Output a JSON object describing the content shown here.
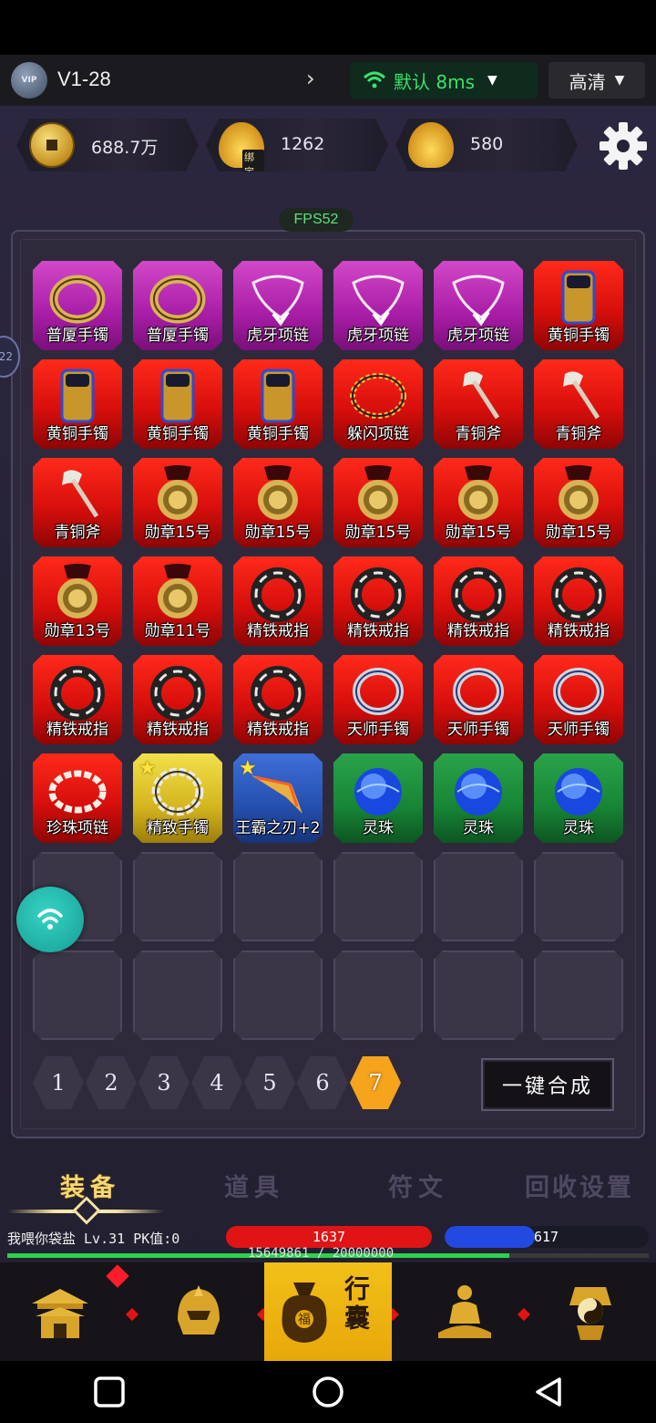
{
  "topbar": {
    "avatar_label": "VIP",
    "version": "V1-28",
    "network_label": "默认 8ms",
    "quality_label": "高清"
  },
  "currencies": [
    {
      "name": "gold-coin",
      "value": "688.7万"
    },
    {
      "name": "bound-ingot",
      "value": "1262",
      "tag": "绑定"
    },
    {
      "name": "ingot",
      "value": "580"
    }
  ],
  "fps": "FPS52",
  "side_tab": "22",
  "inventory": [
    {
      "name": "普厦手镯",
      "rarity": "purple",
      "icon": "bracelet-icon"
    },
    {
      "name": "普厦手镯",
      "rarity": "purple",
      "icon": "bracelet-icon"
    },
    {
      "name": "虎牙项链",
      "rarity": "purple",
      "icon": "necklace-icon"
    },
    {
      "name": "虎牙项链",
      "rarity": "purple",
      "icon": "necklace-icon"
    },
    {
      "name": "虎牙项链",
      "rarity": "purple",
      "icon": "necklace-icon"
    },
    {
      "name": "黄铜手镯",
      "rarity": "red",
      "icon": "cuff-icon"
    },
    {
      "name": "黄铜手镯",
      "rarity": "red",
      "icon": "cuff-icon"
    },
    {
      "name": "黄铜手镯",
      "rarity": "red",
      "icon": "cuff-icon"
    },
    {
      "name": "黄铜手镯",
      "rarity": "red",
      "icon": "cuff-icon"
    },
    {
      "name": "躲闪项链",
      "rarity": "red",
      "icon": "bead-necklace-icon"
    },
    {
      "name": "青铜斧",
      "rarity": "red",
      "icon": "axe-icon"
    },
    {
      "name": "青铜斧",
      "rarity": "red",
      "icon": "axe-icon"
    },
    {
      "name": "青铜斧",
      "rarity": "red",
      "icon": "axe-icon"
    },
    {
      "name": "勋章15号",
      "rarity": "red",
      "icon": "medal-icon"
    },
    {
      "name": "勋章15号",
      "rarity": "red",
      "icon": "medal-icon"
    },
    {
      "name": "勋章15号",
      "rarity": "red",
      "icon": "medal-icon"
    },
    {
      "name": "勋章15号",
      "rarity": "red",
      "icon": "medal-icon"
    },
    {
      "name": "勋章15号",
      "rarity": "red",
      "icon": "medal-icon"
    },
    {
      "name": "勋章13号",
      "rarity": "red",
      "icon": "medal-icon"
    },
    {
      "name": "勋章11号",
      "rarity": "red",
      "icon": "medal-icon"
    },
    {
      "name": "精铁戒指",
      "rarity": "red",
      "icon": "ring-icon"
    },
    {
      "name": "精铁戒指",
      "rarity": "red",
      "icon": "ring-icon"
    },
    {
      "name": "精铁戒指",
      "rarity": "red",
      "icon": "ring-icon"
    },
    {
      "name": "精铁戒指",
      "rarity": "red",
      "icon": "ring-icon"
    },
    {
      "name": "精铁戒指",
      "rarity": "red",
      "icon": "ring-icon"
    },
    {
      "name": "精铁戒指",
      "rarity": "red",
      "icon": "ring-icon"
    },
    {
      "name": "精铁戒指",
      "rarity": "red",
      "icon": "ring-icon"
    },
    {
      "name": "天师手镯",
      "rarity": "red",
      "icon": "silver-bracelet-icon"
    },
    {
      "name": "天师手镯",
      "rarity": "red",
      "icon": "silver-bracelet-icon"
    },
    {
      "name": "天师手镯",
      "rarity": "red",
      "icon": "silver-bracelet-icon"
    },
    {
      "name": "珍珠项链",
      "rarity": "red",
      "icon": "pearl-necklace-icon"
    },
    {
      "name": "精致手镯",
      "rarity": "gold",
      "icon": "chain-bracelet-icon",
      "star": true
    },
    {
      "name": "王霸之刃+2",
      "rarity": "blue",
      "icon": "blade-icon",
      "star": true
    },
    {
      "name": "灵珠",
      "rarity": "green",
      "icon": "spirit-orb-icon"
    },
    {
      "name": "灵珠",
      "rarity": "green",
      "icon": "spirit-orb-icon"
    },
    {
      "name": "灵珠",
      "rarity": "green",
      "icon": "spirit-orb-icon"
    }
  ],
  "empty_slots": 12,
  "pagination": {
    "pages": [
      "1",
      "2",
      "3",
      "4",
      "5",
      "6",
      "7"
    ],
    "active": "7"
  },
  "merge_button": "一键合成",
  "tabs": [
    {
      "label": "装备",
      "active": true
    },
    {
      "label": "道具",
      "active": false
    },
    {
      "label": "符文",
      "active": false
    },
    {
      "label": "回收设置",
      "active": false
    }
  ],
  "player": {
    "info": "我喂你袋盐 Lv.31 PK值:0",
    "hp": "1637",
    "mp": "617",
    "mp_fraction": 0.44,
    "exp": "15649861 / 20000000",
    "exp_fraction": 0.7825
  },
  "bottom_nav": {
    "bag_label": "行囊",
    "items": [
      "palace-icon",
      "helmet-icon",
      "bag-icon",
      "meditation-icon",
      "taiji-icon"
    ]
  },
  "colors": {
    "purple": "#b021b0",
    "red": "#e01010",
    "gold": "#d9b820",
    "blue": "#2a55b8",
    "green": "#188a38",
    "accent": "#f5a41c"
  }
}
